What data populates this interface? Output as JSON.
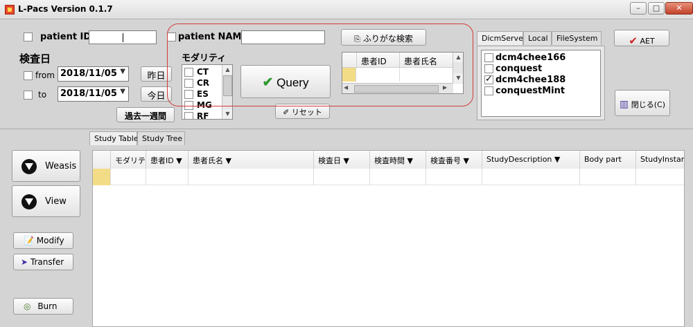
{
  "window": {
    "title": "L-Pacs Version 0.1.7",
    "minimize": "–",
    "maximize": "□",
    "close": "✕"
  },
  "search": {
    "patient_id_label": "patient ID",
    "patient_id_value": "",
    "patient_name_label": "patient NAME",
    "patient_name_value": "",
    "exam_date_label": "検査日",
    "from_label": "from",
    "from_date": "2018/11/05",
    "to_label": "to",
    "to_date": "2018/11/05",
    "yesterday_button": "昨日",
    "today_button": "今日",
    "past_week_button": "過去一週間",
    "modality_label": "モダリティ",
    "modalities": [
      "CT",
      "CR",
      "ES",
      "MG",
      "RF"
    ],
    "query_button": "Query",
    "furigana_button": "ふりがな検索",
    "reset_button": "リセット",
    "mini_table_headers": [
      "患者ID",
      "患者氏名"
    ]
  },
  "server": {
    "tabs": [
      "DicmServer",
      "Local",
      "FileSystem"
    ],
    "servers": [
      {
        "name": "dcm4chee166",
        "checked": false
      },
      {
        "name": "conquest",
        "checked": false
      },
      {
        "name": "dcm4chee188",
        "checked": true
      },
      {
        "name": "conquestMint",
        "checked": false
      }
    ],
    "aet_button": "AET",
    "close_button": "閉じる(C)"
  },
  "side": {
    "weasis_button": "Weasis",
    "view_button": "View",
    "modify_button": "Modify",
    "transfer_button": "Transfer",
    "burn_button": "Burn"
  },
  "study": {
    "tabs": [
      "Study Table",
      "Study Tree"
    ],
    "columns": [
      "モダリティ",
      "患者ID ▼",
      "患者氏名 ▼",
      "検査日 ▼",
      "検査時間 ▼",
      "検査番号 ▼",
      "StudyDescription ▼",
      "Body part",
      "StudyInstanc"
    ]
  },
  "colors": {
    "highlight": "#d23a3a",
    "row_marker": "#f3dc86",
    "check_green": "#2f9a2f",
    "aet_red": "#cc1f1f"
  }
}
